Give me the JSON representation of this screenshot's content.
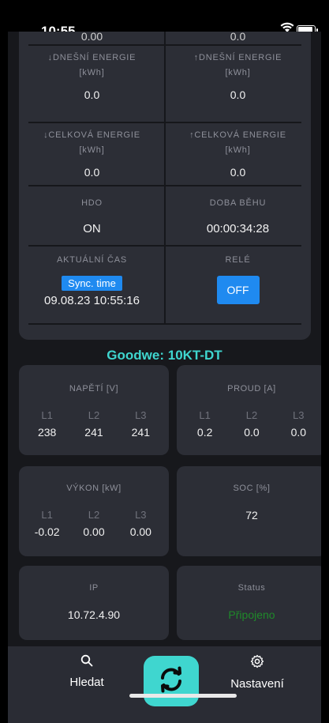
{
  "status_bar": {
    "time": "10:55",
    "signal": "....",
    "wifi_icon": "wifi-icon",
    "battery_icon": "battery-icon"
  },
  "top_card": {
    "partial_left": "0.00",
    "partial_right": "0.0",
    "energy_today_in": {
      "title": "↓DNEŠNÍ ENERGIE",
      "unit": "[kWh]",
      "value": "0.0"
    },
    "energy_today_out": {
      "title": "↑DNEŠNÍ ENERGIE",
      "unit": "[kWh]",
      "value": "0.0"
    },
    "energy_total_in": {
      "title": "↓CELKOVÁ ENERGIE",
      "unit": "[kWh]",
      "value": "0.0"
    },
    "energy_total_out": {
      "title": "↑CELKOVÁ ENERGIE",
      "unit": "[kWh]",
      "value": "0.0"
    },
    "hdo": {
      "title": "HDO",
      "value": "ON"
    },
    "runtime": {
      "title": "DOBA BĚHU",
      "value": "00:00:34:28"
    },
    "current_time": {
      "title": "AKTUÁLNÍ ČAS",
      "sync_button": "Sync. time",
      "value": "09.08.23 10:55:16"
    },
    "relay": {
      "title": "RELÉ",
      "button": "OFF"
    }
  },
  "device_title": "Goodwe: 10KT-DT",
  "voltage": {
    "title": "NAPĚTÍ [V]",
    "phases": [
      {
        "name": "L1",
        "value": "238"
      },
      {
        "name": "L2",
        "value": "241"
      },
      {
        "name": "L3",
        "value": "241"
      }
    ]
  },
  "current": {
    "title": "PROUD [A]",
    "phases": [
      {
        "name": "L1",
        "value": "0.2"
      },
      {
        "name": "L2",
        "value": "0.0"
      },
      {
        "name": "L3",
        "value": "0.0"
      }
    ]
  },
  "power": {
    "title": "VÝKON [kW]",
    "phases": [
      {
        "name": "L1",
        "value": "-0.02"
      },
      {
        "name": "L2",
        "value": "0.00"
      },
      {
        "name": "L3",
        "value": "0.00"
      }
    ]
  },
  "soc": {
    "title": "SOC [%]",
    "value": "72"
  },
  "ip": {
    "title": "IP",
    "value": "10.72.4.90"
  },
  "status": {
    "title": "Status",
    "value": "Připojeno",
    "color": "#1f8a2a"
  },
  "tab_bar": {
    "search": {
      "label": "Hledat",
      "icon": "search-icon"
    },
    "refresh": {
      "icon": "refresh-icon"
    },
    "settings": {
      "label": "Nastavení",
      "icon": "gear-icon"
    }
  },
  "colors": {
    "accent": "#3fd6cf",
    "button_blue": "#1f8af0",
    "card_bg": "#2c2e36",
    "app_bg": "#17181c"
  }
}
